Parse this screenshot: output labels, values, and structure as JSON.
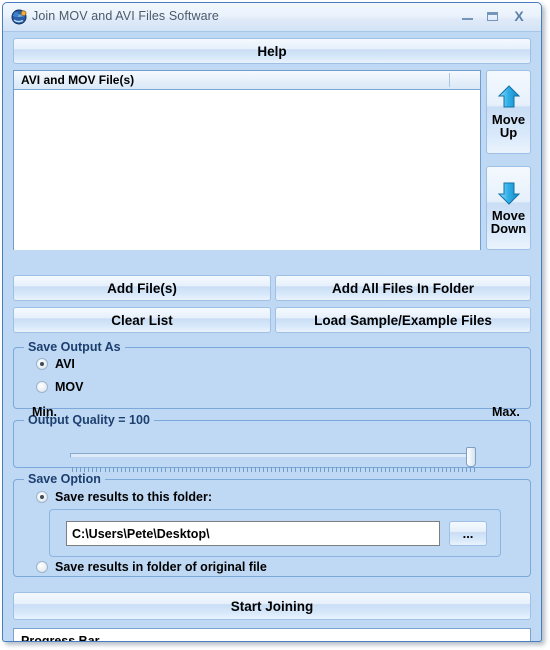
{
  "window": {
    "title": "Join MOV and AVI Files Software",
    "icon": "app-globe-icon",
    "minimize_label": "Minimize",
    "maximize_label": "Maximize",
    "close_label": "X"
  },
  "toolbar": {
    "help_label": "Help"
  },
  "file_list": {
    "column_header": "AVI and MOV File(s)",
    "rows": []
  },
  "move_buttons": {
    "up_line1": "Move",
    "up_line2": "Up",
    "down_line1": "Move",
    "down_line2": "Down"
  },
  "actions": {
    "add_files": "Add File(s)",
    "add_all_files_in_folder": "Add All Files In Folder",
    "clear_list": "Clear List",
    "load_sample": "Load Sample/Example Files"
  },
  "save_output_as": {
    "title": "Save Output As",
    "options": [
      {
        "label": "AVI",
        "checked": true
      },
      {
        "label": "MOV",
        "checked": false
      }
    ]
  },
  "output_quality": {
    "title": "Output Quality = 100",
    "value": 100,
    "min_label": "Min.",
    "max_label": "Max."
  },
  "save_option": {
    "title": "Save Option",
    "option_folder_label": "Save results to this folder:",
    "option_folder_checked": true,
    "path_value": "C:\\Users\\Pete\\Desktop\\",
    "path_placeholder": "C:\\",
    "browse_label": "...",
    "option_original_label": "Save results in folder of original file",
    "option_original_checked": false
  },
  "footer": {
    "start_label": "Start Joining",
    "progress_label": "Progress Bar"
  },
  "colors": {
    "window_background": "#bfd9f5",
    "accent_border": "#4a7dbd",
    "group_title": "#1d3f6e",
    "arrow_blue": "#29a8e0"
  }
}
